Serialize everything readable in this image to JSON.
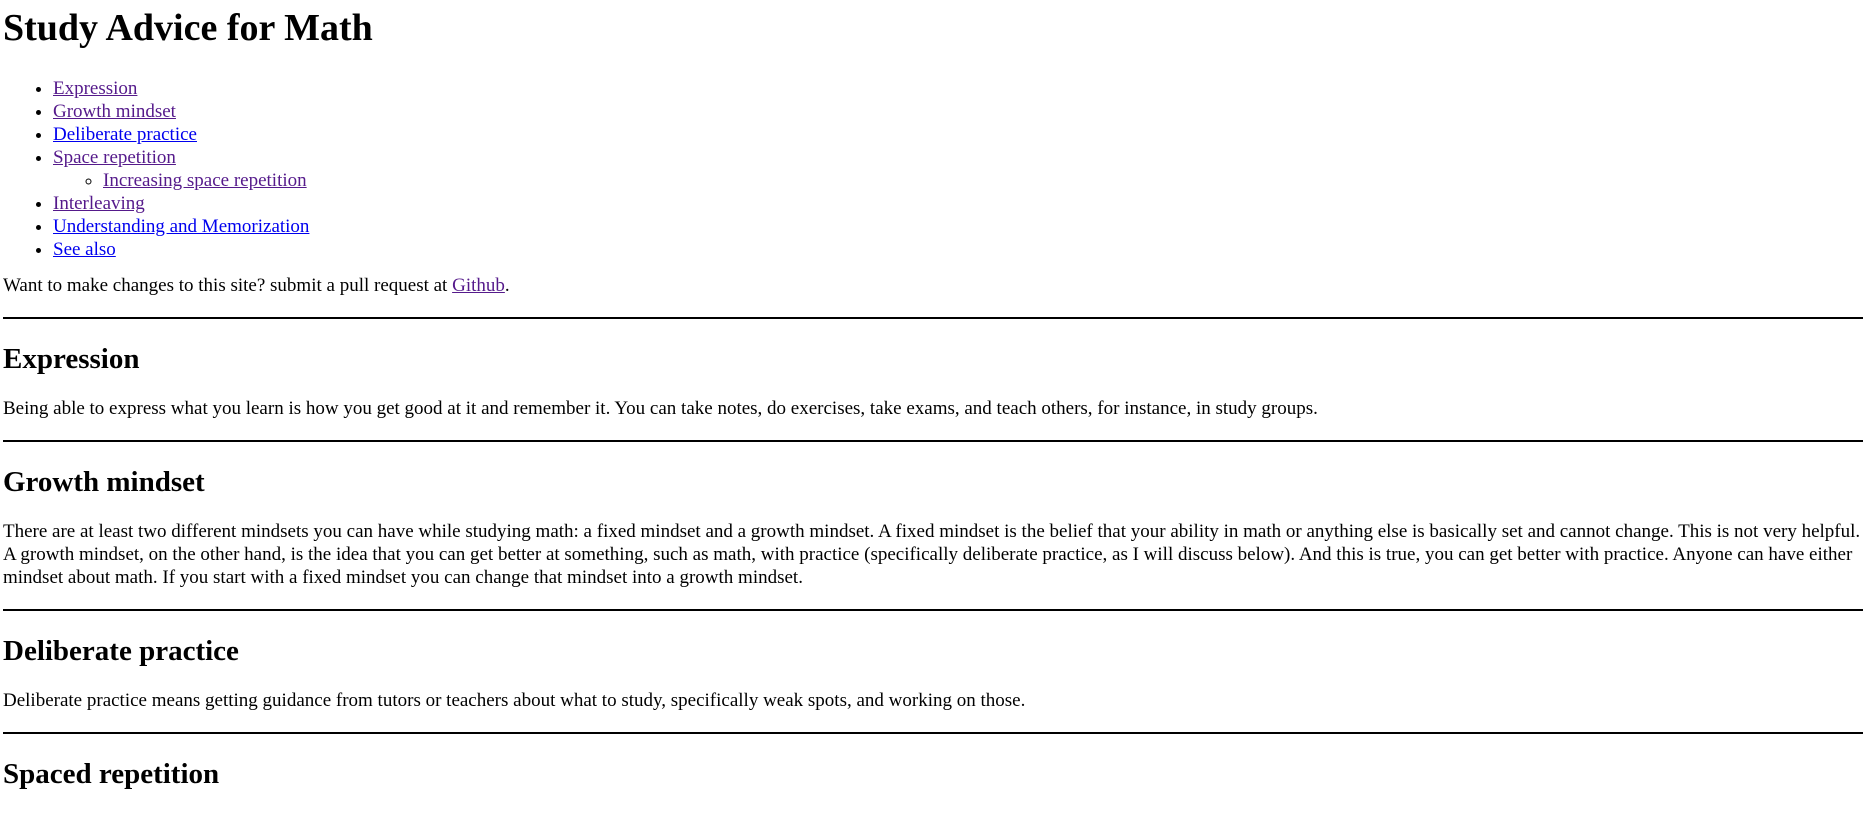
{
  "title": "Study Advice for Math",
  "toc": {
    "items": [
      {
        "label": "Expression"
      },
      {
        "label": "Growth mindset"
      },
      {
        "label": "Deliberate practice"
      },
      {
        "label": "Space repetition",
        "sub": [
          {
            "label": "Increasing space repetition"
          }
        ]
      },
      {
        "label": "Interleaving"
      },
      {
        "label": "Understanding and Memorization"
      },
      {
        "label": "See also"
      }
    ]
  },
  "contribute": {
    "text": "Want to make changes to this site? submit a pull request at ",
    "link": "Github",
    "suffix": "."
  },
  "sections": {
    "expression": {
      "heading": "Expression",
      "body": "Being able to express what you learn is how you get good at it and remember it. You can take notes, do exercises, take exams, and teach others, for instance, in study groups."
    },
    "growth": {
      "heading": "Growth mindset",
      "body": "There are at least two different mindsets you can have while studying math: a fixed mindset and a growth mindset. A fixed mindset is the belief that your ability in math or anything else is basically set and cannot change. This is not very helpful. A growth mindset, on the other hand, is the idea that you can get better at something, such as math, with practice (specifically deliberate practice, as I will discuss below). And this is true, you can get better with practice. Anyone can have either mindset about math. If you start with a fixed mindset you can change that mindset into a growth mindset."
    },
    "deliberate": {
      "heading": "Deliberate practice",
      "body": "Deliberate practice means getting guidance from tutors or teachers about what to study, specifically weak spots, and working on those."
    },
    "spaced": {
      "heading": "Spaced repetition"
    }
  },
  "colors": {
    "link_visited": "#551A8B",
    "link_unvisited": "#0000EE"
  }
}
